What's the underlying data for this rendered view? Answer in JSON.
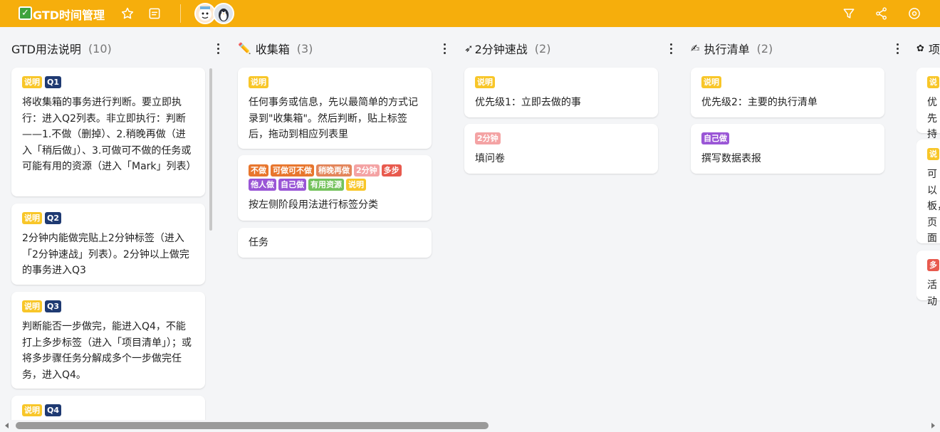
{
  "header": {
    "title": "GTD时间管理",
    "accent_color": "#f6ae0c",
    "icons": [
      "star-icon",
      "description-icon",
      "filter-icon",
      "share-icon",
      "settings-icon"
    ]
  },
  "lists": [
    {
      "title": "GTD用法说明",
      "count": "(10)",
      "cards": [
        {
          "labels": [
            "说明",
            "Q1"
          ],
          "text": "将收集箱的事务进行判断。要立即执行：进入Q2列表。非立即执行：判断——1.不做（删掉）、2.稍晚再做（进入「稍后做」）、3.可做可不做的任务或可能有用的资源（进入「Mark」列表）"
        },
        {
          "labels": [
            "说明",
            "Q2"
          ],
          "text": "2分钟内能做完贴上2分钟标签（进入「2分钟速战」列表）。2分钟以上做完的事务进入Q3"
        },
        {
          "labels": [
            "说明",
            "Q3"
          ],
          "text": "判断能否一步做完，能进入Q4，不能打上多步标签（进入「项目清单」）；或将多步骤任务分解成多个一步做完任务，进入Q4。"
        },
        {
          "labels": [
            "说明",
            "Q4"
          ],
          "text": ""
        }
      ]
    },
    {
      "title": "收集箱",
      "icon": "✏️",
      "count": "(3)",
      "cards": [
        {
          "labels": [
            "说明"
          ],
          "text": "任何事务或信息，先以最简单的方式记录到\"收集箱\"。然后判断，贴上标签后，拖动到相应列表里"
        },
        {
          "labels": [
            "不做",
            "可做可不做",
            "稍晚再做",
            "2分钟",
            "多步",
            "他人做",
            "自己做",
            "有用资源",
            "说明"
          ],
          "text": "按左侧阶段用法进行标签分类"
        },
        {
          "labels": [],
          "text": "任务"
        }
      ]
    },
    {
      "title": "2分钟速战",
      "icon": "➶",
      "count": "(2)",
      "cards": [
        {
          "labels": [
            "说明"
          ],
          "text": "优先级1：立即去做的事"
        },
        {
          "labels": [
            "2分钟"
          ],
          "text": "填问卷"
        }
      ]
    },
    {
      "title": "执行清单",
      "icon": "✍",
      "count": "(2)",
      "cards": [
        {
          "labels": [
            "说明"
          ],
          "text": "优先级2：主要的执行清单"
        },
        {
          "labels": [
            "自己做"
          ],
          "text": "撰写数据表报"
        }
      ]
    },
    {
      "title": "项",
      "icon": "✿",
      "count": "",
      "cards": [
        {
          "labels": [
            "说"
          ],
          "text": "优先持续"
        },
        {
          "labels": [
            "说"
          ],
          "text": "可以板，页面"
        },
        {
          "labels": [
            "多"
          ],
          "text": "活动"
        }
      ]
    }
  ]
}
